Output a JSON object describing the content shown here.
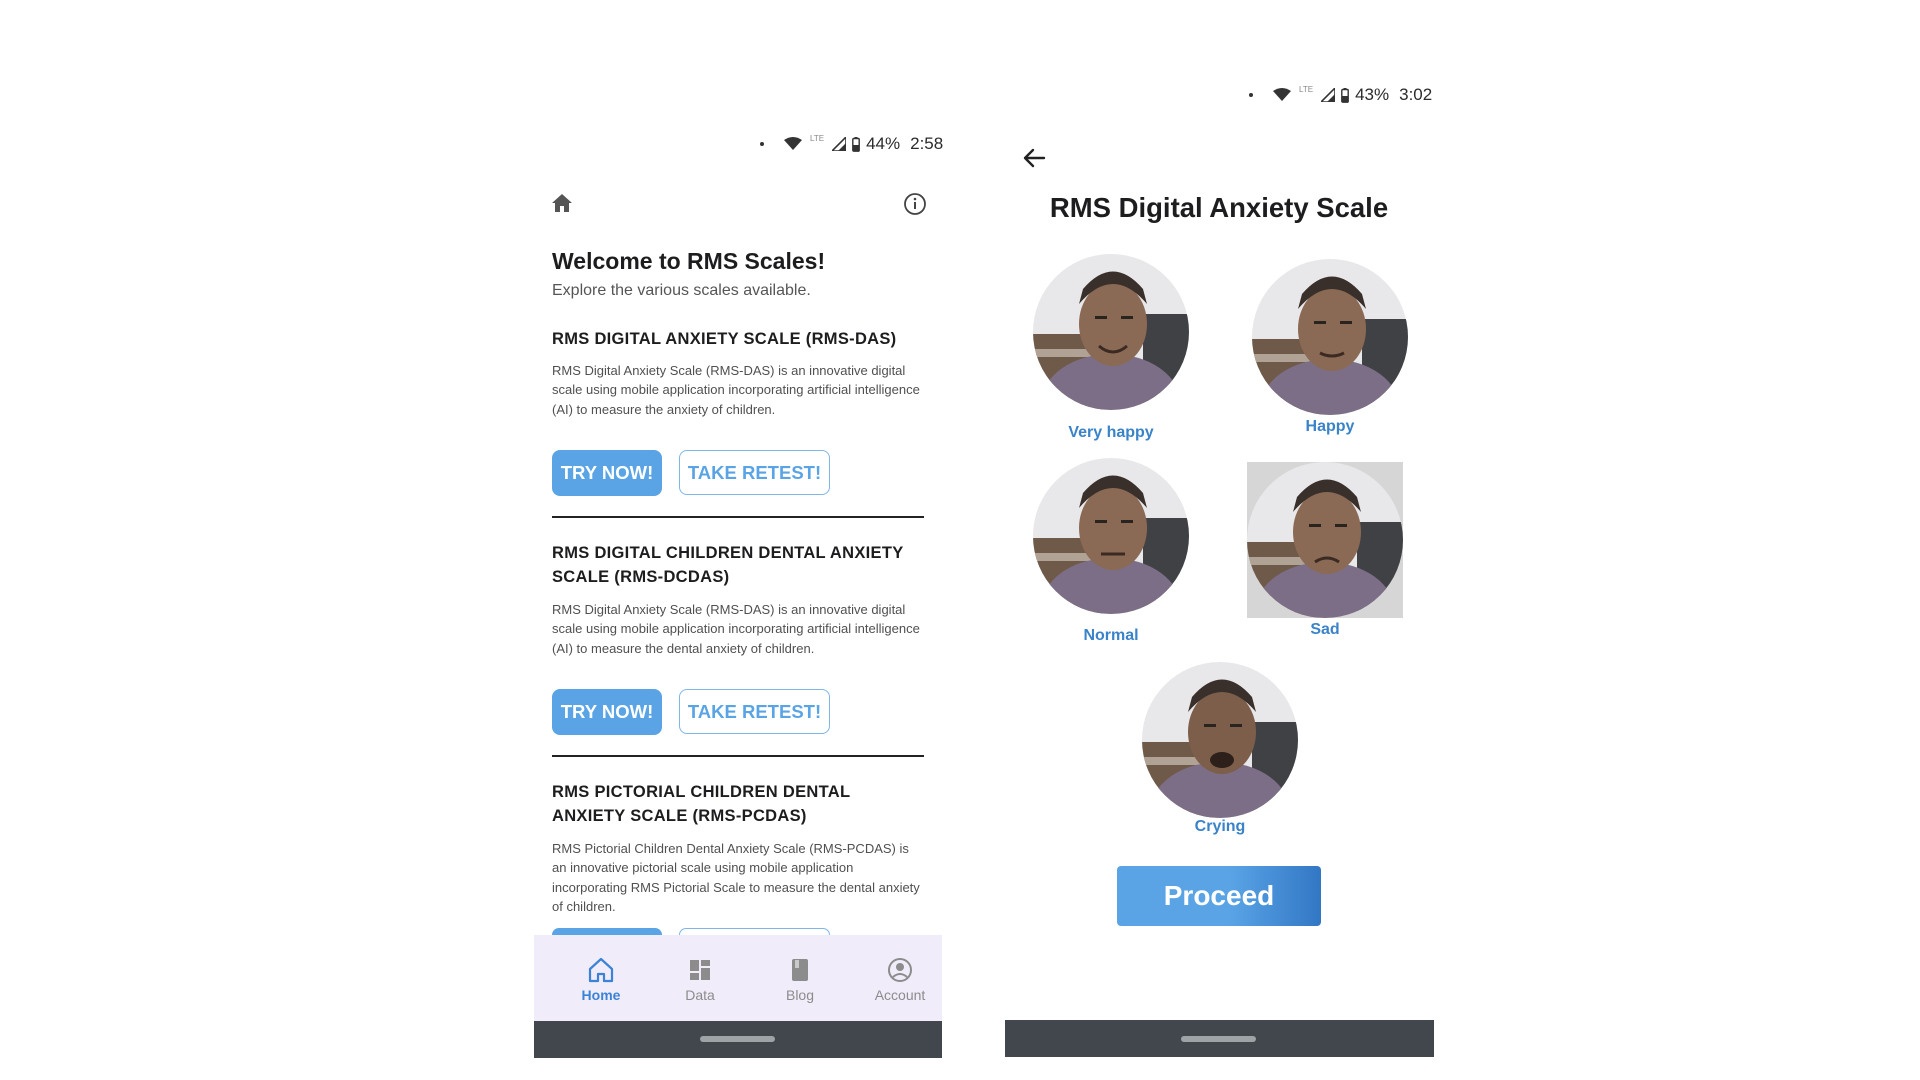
{
  "screen1": {
    "status": {
      "battery": "44%",
      "time": "2:58",
      "network": "LTE"
    },
    "header": {
      "home_icon": "home-icon",
      "info_icon": "info-icon"
    },
    "welcome_title": "Welcome to RMS Scales!",
    "welcome_subtitle": "Explore the various scales available.",
    "sections": [
      {
        "title": "RMS DIGITAL ANXIETY SCALE (RMS-DAS)",
        "description": "RMS Digital Anxiety Scale (RMS-DAS) is an innovative digital scale using mobile application incorporating artificial intelligence (AI) to measure the anxiety of children.",
        "try_label": "TRY NOW!",
        "retest_label": "TAKE RETEST!"
      },
      {
        "title": "RMS DIGITAL CHILDREN DENTAL ANXIETY SCALE (RMS-DCDAS)",
        "description": "RMS Digital Anxiety Scale (RMS-DAS) is an innovative digital scale using mobile application incorporating artificial intelligence (AI) to measure the dental anxiety of children.",
        "try_label": "TRY NOW!",
        "retest_label": "TAKE RETEST!"
      },
      {
        "title": "RMS PICTORIAL CHILDREN DENTAL ANXIETY SCALE (RMS-PCDAS)",
        "description": "RMS Pictorial Children Dental Anxiety Scale (RMS-PCDAS) is an innovative pictorial scale using mobile application incorporating RMS Pictorial Scale to measure the dental anxiety of children."
      }
    ],
    "nav": [
      {
        "label": "Home",
        "icon": "home-icon",
        "active": true
      },
      {
        "label": "Data",
        "icon": "dashboard-icon",
        "active": false
      },
      {
        "label": "Blog",
        "icon": "book-icon",
        "active": false
      },
      {
        "label": "Account",
        "icon": "account-circle-icon",
        "active": false
      }
    ]
  },
  "screen2": {
    "status": {
      "battery": "43%",
      "time": "3:02",
      "network": "LTE"
    },
    "back_icon": "arrow-left-icon",
    "title": "RMS Digital Anxiety Scale",
    "faces": [
      {
        "label": "Very happy",
        "selected": false
      },
      {
        "label": "Happy",
        "selected": false
      },
      {
        "label": "Normal",
        "selected": false
      },
      {
        "label": "Sad",
        "selected": true
      },
      {
        "label": "Crying",
        "selected": false
      }
    ],
    "proceed_label": "Proceed"
  },
  "colors": {
    "accent": "#5aa4e6",
    "label_blue": "#3a83c9",
    "nav_bg": "#f1ecfa",
    "sysbar": "#41474c"
  }
}
